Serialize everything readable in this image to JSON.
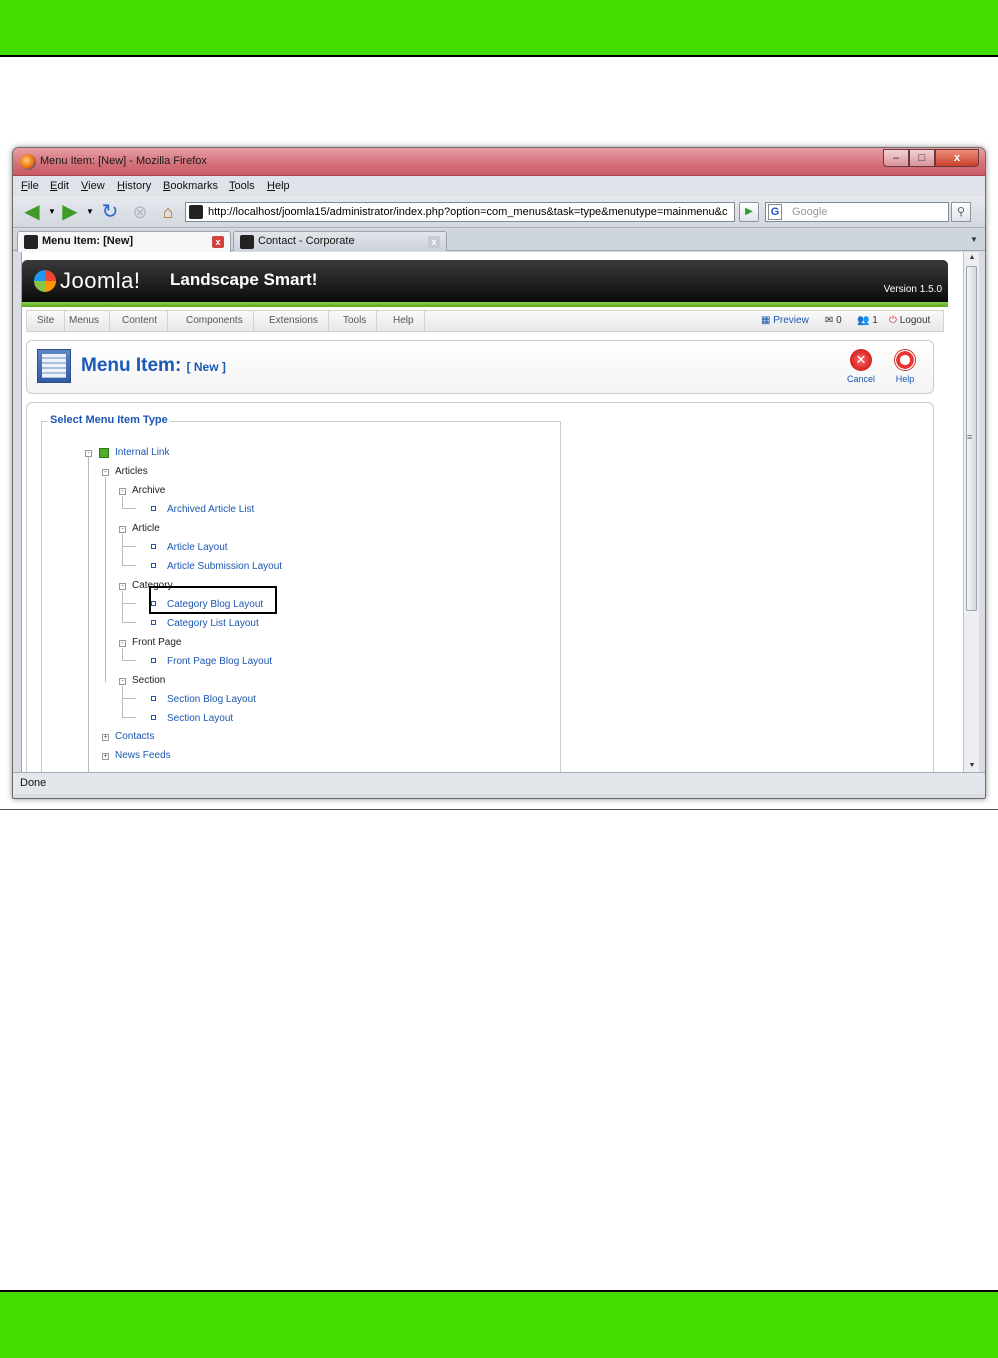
{
  "window": {
    "title": "Menu Item: [New] - Mozilla Firefox",
    "controls": {
      "minimize": "–",
      "maximize": "□",
      "close": "x"
    }
  },
  "menubar": [
    "File",
    "Edit",
    "View",
    "History",
    "Bookmarks",
    "Tools",
    "Help"
  ],
  "navbar": {
    "url": "http://localhost/joomla15/administrator/index.php?option=com_menus&task=type&menutype=mainmenu&c",
    "search_placeholder": "Google",
    "search_engine_icon": "G"
  },
  "tabs": [
    {
      "label": "Menu Item: [New]",
      "active": true
    },
    {
      "label": "Contact - Corporate",
      "active": false
    }
  ],
  "status": "Done",
  "joomla": {
    "logo_text": "Joomla!",
    "site_name": "Landscape Smart!",
    "version": "Version 1.5.0",
    "menu": [
      "Site",
      "Menus",
      "Content",
      "Components",
      "Extensions",
      "Tools",
      "Help"
    ],
    "status_items": {
      "preview": "Preview",
      "messages": "0",
      "users": "1",
      "logout": "Logout"
    },
    "page_title": "Menu Item:",
    "page_subtitle": "[ New ]",
    "toolbar": {
      "cancel": "Cancel",
      "help": "Help"
    },
    "fieldset_legend": "Select Menu Item Type",
    "tree": {
      "internal_link": "Internal Link",
      "articles": "Articles",
      "archive": "Archive",
      "archived_article_list": "Archived Article List",
      "article": "Article",
      "article_layout": "Article Layout",
      "article_submission_layout": "Article Submission Layout",
      "category": "Category",
      "category_blog_layout": "Category Blog Layout",
      "category_list_layout": "Category List Layout",
      "front_page": "Front Page",
      "front_page_blog_layout": "Front Page Blog Layout",
      "section": "Section",
      "section_blog_layout": "Section Blog Layout",
      "section_layout": "Section Layout",
      "contacts": "Contacts",
      "news_feeds": "News Feeds"
    }
  }
}
